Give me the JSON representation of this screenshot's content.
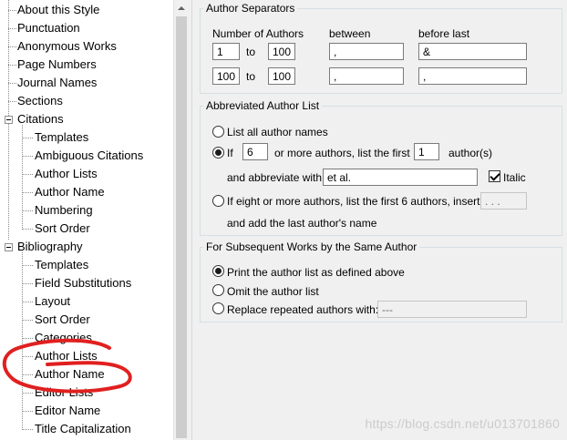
{
  "tree": {
    "items": [
      {
        "label": "About this Style"
      },
      {
        "label": "Punctuation"
      },
      {
        "label": "Anonymous Works"
      },
      {
        "label": "Page Numbers"
      },
      {
        "label": "Journal Names"
      },
      {
        "label": "Sections"
      },
      {
        "label": "Citations"
      },
      {
        "label": "Templates"
      },
      {
        "label": "Ambiguous Citations"
      },
      {
        "label": "Author Lists"
      },
      {
        "label": "Author Name"
      },
      {
        "label": "Numbering"
      },
      {
        "label": "Sort Order"
      },
      {
        "label": "Bibliography"
      },
      {
        "label": "Templates"
      },
      {
        "label": "Field Substitutions"
      },
      {
        "label": "Layout"
      },
      {
        "label": "Sort Order"
      },
      {
        "label": "Categories"
      },
      {
        "label": "Author Lists"
      },
      {
        "label": "Author Name"
      },
      {
        "label": "Editor Lists"
      },
      {
        "label": "Editor Name"
      },
      {
        "label": "Title Capitalization"
      }
    ]
  },
  "separators": {
    "legend": "Author Separators",
    "col_number": "Number of Authors",
    "col_between": "between",
    "col_before_last": "before last",
    "to_label": "to",
    "rows": [
      {
        "from": "1",
        "to": "100",
        "between": ",",
        "before_last": "&"
      },
      {
        "from": "100",
        "to": "100",
        "between": ",",
        "before_last": ","
      }
    ]
  },
  "abbrev": {
    "legend": "Abbreviated Author List",
    "list_all": "List all author names",
    "if_label": "If",
    "if_count": "6",
    "or_more": "or more authors, list the first",
    "first_count": "1",
    "authors_suffix": "author(s)",
    "abbrev_with_label": "and abbreviate with:",
    "abbrev_with_value": "et al.",
    "italic_label": "Italic",
    "eight_label": "If eight or more authors, list the first 6 authors, insert:",
    "eight_value": ". . .",
    "add_last": "and add the last author's name"
  },
  "subsequent": {
    "legend": "For Subsequent Works by the Same Author",
    "print_label": "Print the author list as defined above",
    "omit_label": "Omit the author list",
    "replace_label": "Replace repeated authors with:",
    "replace_value": "---"
  },
  "watermark": "https://blog.csdn.net/u013701860",
  "colors": {
    "annotation": "#e0201f",
    "panel_bg": "#f0f0f0"
  }
}
